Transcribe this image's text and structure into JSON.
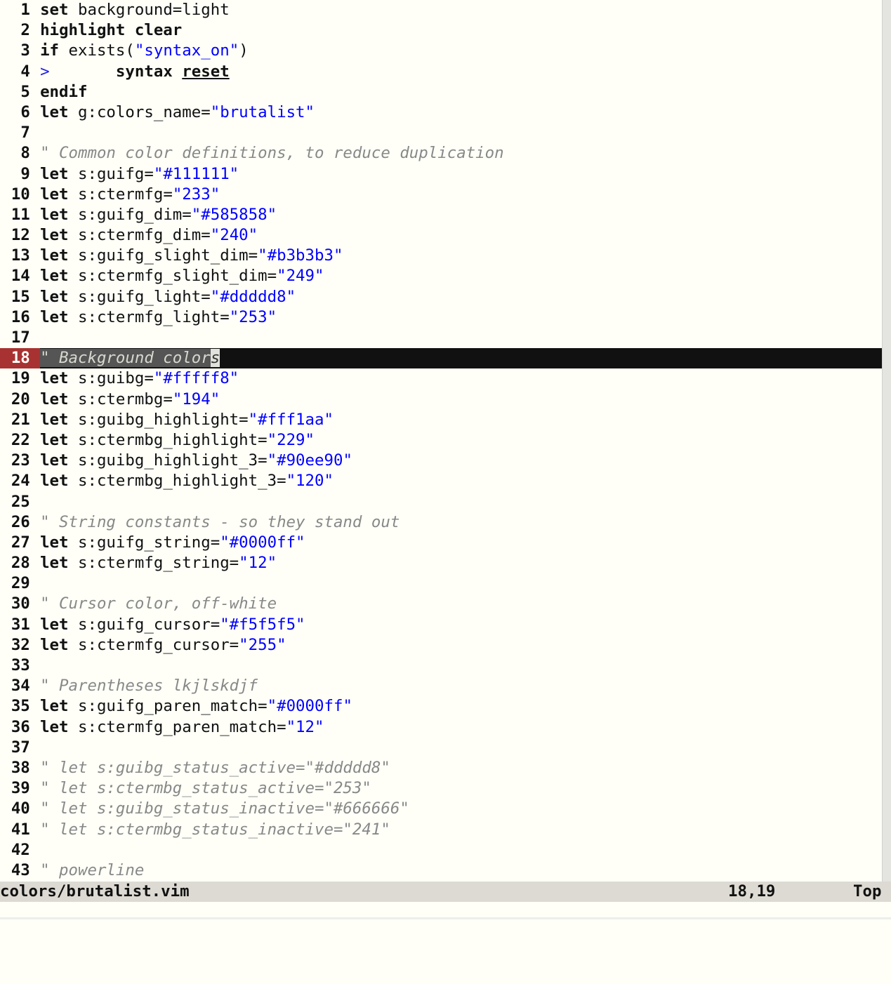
{
  "window": {
    "title": "colors/brutalist.vim",
    "background_color": "#fffff8",
    "foreground_color": "#111111",
    "string_color": "#0000ff",
    "comment_color": "#888888",
    "cursorline_bg": "#111111",
    "cursorline_number_bg": "#a83232",
    "statusline_bg": "#dddad3",
    "cursor_block_bg": "#e2e2dd",
    "word_highlight_bg": "#555555"
  },
  "statusline": {
    "filename": "colors/brutalist.vim",
    "ruler": "18,19",
    "position": "Top"
  },
  "cmdline": {
    "text": ""
  },
  "buffer": {
    "cursor_line": 18,
    "lines": [
      {
        "n": "1",
        "tokens": [
          {
            "t": "kw",
            "v": "set"
          },
          {
            "t": "ident",
            "v": " background=light"
          }
        ]
      },
      {
        "n": "2",
        "tokens": [
          {
            "t": "kw",
            "v": "highlight clear"
          }
        ]
      },
      {
        "n": "3",
        "tokens": [
          {
            "t": "kw",
            "v": "if"
          },
          {
            "t": "ident",
            "v": " exists"
          },
          {
            "t": "punct",
            "v": "("
          },
          {
            "t": "str",
            "v": "\"syntax_on\""
          },
          {
            "t": "punct",
            "v": ")"
          }
        ]
      },
      {
        "n": "4",
        "tokens": [
          {
            "t": "tabmark",
            "v": ">"
          },
          {
            "t": "ident",
            "v": "       "
          },
          {
            "t": "kw",
            "v": "syntax "
          },
          {
            "t": "special",
            "v": "reset"
          }
        ]
      },
      {
        "n": "5",
        "tokens": [
          {
            "t": "kw",
            "v": "endif"
          }
        ]
      },
      {
        "n": "6",
        "tokens": [
          {
            "t": "kw",
            "v": "let"
          },
          {
            "t": "ident",
            "v": " g:colors_name="
          },
          {
            "t": "str",
            "v": "\"brutalist\""
          }
        ]
      },
      {
        "n": "7",
        "tokens": []
      },
      {
        "n": "8",
        "tokens": [
          {
            "t": "comment",
            "v": "\" Common color definitions, to reduce duplication"
          }
        ]
      },
      {
        "n": "9",
        "tokens": [
          {
            "t": "kw",
            "v": "let"
          },
          {
            "t": "ident",
            "v": " s:guifg="
          },
          {
            "t": "str",
            "v": "\"#111111\""
          }
        ]
      },
      {
        "n": "10",
        "tokens": [
          {
            "t": "kw",
            "v": "let"
          },
          {
            "t": "ident",
            "v": " s:ctermfg="
          },
          {
            "t": "str",
            "v": "\"233\""
          }
        ]
      },
      {
        "n": "11",
        "tokens": [
          {
            "t": "kw",
            "v": "let"
          },
          {
            "t": "ident",
            "v": " s:guifg_dim="
          },
          {
            "t": "str",
            "v": "\"#585858\""
          }
        ]
      },
      {
        "n": "12",
        "tokens": [
          {
            "t": "kw",
            "v": "let"
          },
          {
            "t": "ident",
            "v": " s:ctermfg_dim="
          },
          {
            "t": "str",
            "v": "\"240\""
          }
        ]
      },
      {
        "n": "13",
        "tokens": [
          {
            "t": "kw",
            "v": "let"
          },
          {
            "t": "ident",
            "v": " s:guifg_slight_dim="
          },
          {
            "t": "str",
            "v": "\"#b3b3b3\""
          }
        ]
      },
      {
        "n": "14",
        "tokens": [
          {
            "t": "kw",
            "v": "let"
          },
          {
            "t": "ident",
            "v": " s:ctermfg_slight_dim="
          },
          {
            "t": "str",
            "v": "\"249\""
          }
        ]
      },
      {
        "n": "15",
        "tokens": [
          {
            "t": "kw",
            "v": "let"
          },
          {
            "t": "ident",
            "v": " s:guifg_light="
          },
          {
            "t": "str",
            "v": "\"#ddddd8\""
          }
        ]
      },
      {
        "n": "16",
        "tokens": [
          {
            "t": "kw",
            "v": "let"
          },
          {
            "t": "ident",
            "v": " s:ctermfg_light="
          },
          {
            "t": "str",
            "v": "\"253\""
          }
        ]
      },
      {
        "n": "17",
        "tokens": []
      },
      {
        "n": "18",
        "cursor": true,
        "word_hl": "\" Background color",
        "cursor_char": "s",
        "tokens": [
          {
            "t": "comment",
            "v": "\" Background colors"
          }
        ]
      },
      {
        "n": "19",
        "tokens": [
          {
            "t": "kw",
            "v": "let"
          },
          {
            "t": "ident",
            "v": " s:guibg="
          },
          {
            "t": "str",
            "v": "\"#fffff8\""
          }
        ]
      },
      {
        "n": "20",
        "tokens": [
          {
            "t": "kw",
            "v": "let"
          },
          {
            "t": "ident",
            "v": " s:ctermbg="
          },
          {
            "t": "str",
            "v": "\"194\""
          }
        ]
      },
      {
        "n": "21",
        "tokens": [
          {
            "t": "kw",
            "v": "let"
          },
          {
            "t": "ident",
            "v": " s:guibg_highlight="
          },
          {
            "t": "str",
            "v": "\"#fff1aa\""
          }
        ]
      },
      {
        "n": "22",
        "tokens": [
          {
            "t": "kw",
            "v": "let"
          },
          {
            "t": "ident",
            "v": " s:ctermbg_highlight="
          },
          {
            "t": "str",
            "v": "\"229\""
          }
        ]
      },
      {
        "n": "23",
        "tokens": [
          {
            "t": "kw",
            "v": "let"
          },
          {
            "t": "ident",
            "v": " s:guibg_highlight_3="
          },
          {
            "t": "str",
            "v": "\"#90ee90\""
          }
        ]
      },
      {
        "n": "24",
        "tokens": [
          {
            "t": "kw",
            "v": "let"
          },
          {
            "t": "ident",
            "v": " s:ctermbg_highlight_3="
          },
          {
            "t": "str",
            "v": "\"120\""
          }
        ]
      },
      {
        "n": "25",
        "tokens": []
      },
      {
        "n": "26",
        "tokens": [
          {
            "t": "comment",
            "v": "\" String constants - so they stand out"
          }
        ]
      },
      {
        "n": "27",
        "tokens": [
          {
            "t": "kw",
            "v": "let"
          },
          {
            "t": "ident",
            "v": " s:guifg_string="
          },
          {
            "t": "str",
            "v": "\"#0000ff\""
          }
        ]
      },
      {
        "n": "28",
        "tokens": [
          {
            "t": "kw",
            "v": "let"
          },
          {
            "t": "ident",
            "v": " s:ctermfg_string="
          },
          {
            "t": "str",
            "v": "\"12\""
          }
        ]
      },
      {
        "n": "29",
        "tokens": []
      },
      {
        "n": "30",
        "tokens": [
          {
            "t": "comment",
            "v": "\" Cursor color, off-white"
          }
        ]
      },
      {
        "n": "31",
        "tokens": [
          {
            "t": "kw",
            "v": "let"
          },
          {
            "t": "ident",
            "v": " s:guifg_cursor="
          },
          {
            "t": "str",
            "v": "\"#f5f5f5\""
          }
        ]
      },
      {
        "n": "32",
        "tokens": [
          {
            "t": "kw",
            "v": "let"
          },
          {
            "t": "ident",
            "v": " s:ctermfg_cursor="
          },
          {
            "t": "str",
            "v": "\"255\""
          }
        ]
      },
      {
        "n": "33",
        "tokens": []
      },
      {
        "n": "34",
        "tokens": [
          {
            "t": "comment",
            "v": "\" Parentheses lkjlskdjf"
          }
        ]
      },
      {
        "n": "35",
        "tokens": [
          {
            "t": "kw",
            "v": "let"
          },
          {
            "t": "ident",
            "v": " s:guifg_paren_match="
          },
          {
            "t": "str",
            "v": "\"#0000ff\""
          }
        ]
      },
      {
        "n": "36",
        "tokens": [
          {
            "t": "kw",
            "v": "let"
          },
          {
            "t": "ident",
            "v": " s:ctermfg_paren_match="
          },
          {
            "t": "str",
            "v": "\"12\""
          }
        ]
      },
      {
        "n": "37",
        "tokens": []
      },
      {
        "n": "38",
        "tokens": [
          {
            "t": "comment",
            "v": "\" let s:guibg_status_active=\"#ddddd8\""
          }
        ]
      },
      {
        "n": "39",
        "tokens": [
          {
            "t": "comment",
            "v": "\" let s:ctermbg_status_active=\"253\""
          }
        ]
      },
      {
        "n": "40",
        "tokens": [
          {
            "t": "comment",
            "v": "\" let s:guibg_status_inactive=\"#666666\""
          }
        ]
      },
      {
        "n": "41",
        "tokens": [
          {
            "t": "comment",
            "v": "\" let s:ctermbg_status_inactive=\"241\""
          }
        ]
      },
      {
        "n": "42",
        "tokens": []
      },
      {
        "n": "43",
        "tokens": [
          {
            "t": "comment",
            "v": "\" powerline"
          }
        ]
      }
    ]
  }
}
